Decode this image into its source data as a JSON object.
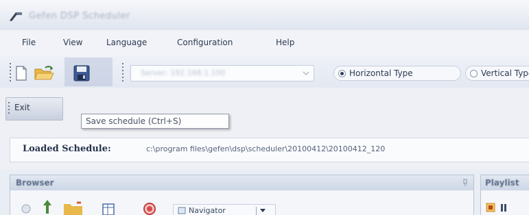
{
  "window": {
    "title": "Gefen DSP Scheduler",
    "app_icon": "app-logo-icon"
  },
  "menu": {
    "items": [
      {
        "label": "File",
        "name": "menu-file"
      },
      {
        "label": "View",
        "name": "menu-view"
      },
      {
        "label": "Language",
        "name": "menu-language"
      },
      {
        "label": "Configuration",
        "name": "menu-configuration"
      },
      {
        "label": "Help",
        "name": "menu-help"
      }
    ]
  },
  "toolbar": {
    "icons": [
      "new-document-icon",
      "open-folder-icon",
      "save-icon"
    ],
    "server_combo_value": "Server: 192.168.1.100",
    "radio_horizontal": "Horizontal Type",
    "radio_vertical": "Vertical Type",
    "radio_selected": "horizontal"
  },
  "toolbar2": {
    "exit_label": "Exit"
  },
  "tooltip": {
    "text": "Save schedule (Ctrl+S)"
  },
  "schedule": {
    "label": "Loaded Schedule:",
    "path": "c:\\program files\\gefen\\dsp\\scheduler\\20100412\\20100412_120"
  },
  "panels": {
    "browser_title": "Browser",
    "playlist_title": "Playlist",
    "navigator_label": "Navigator"
  },
  "colors": {
    "accent": "#2b3e5e",
    "window_bg": "#eef0f5",
    "panel_header": "#cdd6e5"
  }
}
